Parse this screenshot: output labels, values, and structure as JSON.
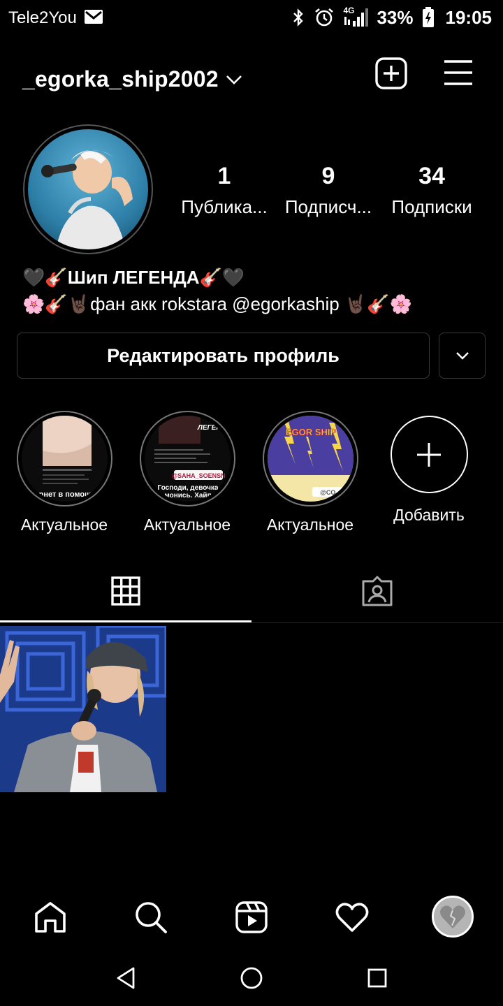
{
  "status_bar": {
    "carrier": "Tele2You",
    "network": "4G",
    "battery": "33%",
    "time": "19:05"
  },
  "header": {
    "username": "_egorka_ship2002"
  },
  "stats": [
    {
      "value": "1",
      "label": "Публика..."
    },
    {
      "value": "9",
      "label": "Подписч..."
    },
    {
      "value": "34",
      "label": "Подписки"
    }
  ],
  "bio": {
    "line1": "🖤🎸Шип ЛЕГЕНДА🎸🖤",
    "line2": "🌸🎸🤘🏿фан акк rokstara @egorkaship 🤘🏿🎸🌸"
  },
  "buttons": {
    "edit_profile": "Редактировать профиль"
  },
  "highlights": [
    {
      "label": "Актуальное"
    },
    {
      "label": "Актуальное"
    },
    {
      "label": "Актуальное"
    },
    {
      "label": "Добавить"
    }
  ],
  "highlight_text": {
    "h1_caption": "рнет в помощ",
    "h2_top": "ЛЕГЕНДА",
    "h2_tag": "@SAHA_SOENSN",
    "h2_caption": "Господи, девочка\nмонись. Хайп",
    "h3_title": "EGOR SHIP",
    "h3_tag": "@CO_U"
  },
  "colors": {
    "background": "#000000",
    "text": "#ffffff",
    "border": "#3a3a3a"
  },
  "icons": {
    "nav": [
      "home-icon",
      "search-icon",
      "reels-icon",
      "heart-icon",
      "profile-avatar"
    ],
    "tabs": [
      "grid-icon",
      "tagged-icon"
    ]
  }
}
